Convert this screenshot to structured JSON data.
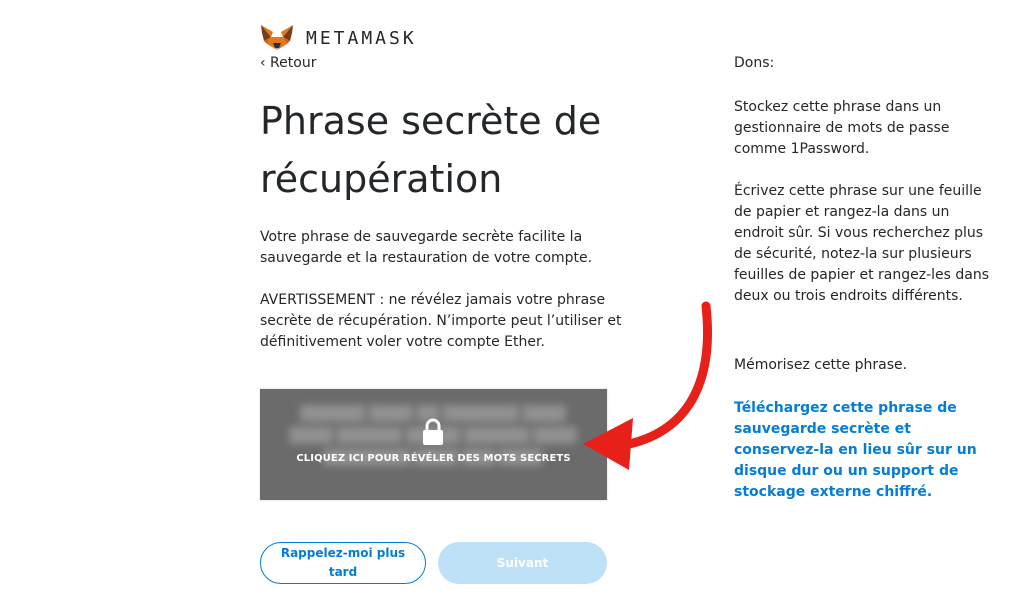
{
  "brand": {
    "name": "METAMASK"
  },
  "nav": {
    "back_label": "‹ Retour"
  },
  "page": {
    "title": "Phrase secrète de récupération",
    "description": "Votre phrase de sauvegarde secrète facilite la sauvegarde et la restauration de votre compte.",
    "warning": "AVERTISSEMENT : ne révélez jamais votre phrase secrète de récupération. N’importe peut l’utiliser et définitivement voler votre compte Ether."
  },
  "reveal_box": {
    "label": "CLIQUEZ ICI POUR RÉVÉLER DES MOTS SECRETS",
    "icon": "lock-icon"
  },
  "buttons": {
    "remind_later": "Rappelez-moi plus tard",
    "next": "Suivant"
  },
  "tips": {
    "heading": "Dons:",
    "items": [
      "Stockez cette phrase dans un gestionnaire de mots de passe comme 1Password.",
      "Écrivez cette phrase sur une feuille de papier et rangez-la dans un endroit sûr. Si vous recherchez plus de sécurité, notez-la sur plusieurs feuilles de papier et rangez-les dans deux ou trois endroits différents.",
      "Mémorisez cette phrase."
    ],
    "download_link": "Téléchargez cette phrase de sauvegarde secrète et conservez-la en lieu sûr sur un disque dur ou un support de stockage externe chiffré."
  },
  "colors": {
    "accent": "#037dd6",
    "disabled_button": "#bfe1f8",
    "reveal_overlay": "#6b6b6b",
    "annotation_arrow": "#e8201a"
  }
}
